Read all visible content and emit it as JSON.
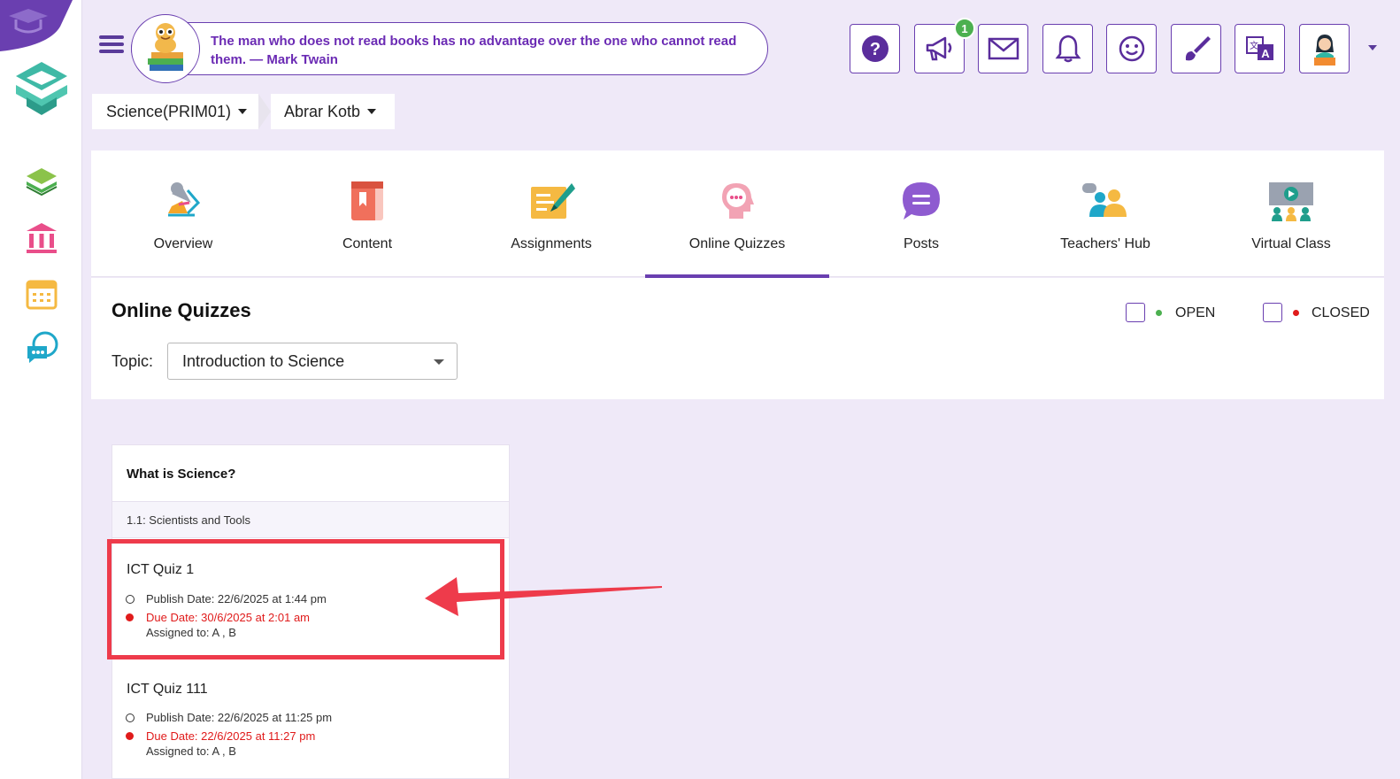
{
  "header": {
    "quote": "The man who does not read books has no advantage over the one who cannot read them. — Mark Twain",
    "notification_badge": "1",
    "buttons": [
      "help-icon",
      "megaphone-icon",
      "mail-icon",
      "bell-icon",
      "smiley-icon",
      "brush-icon",
      "translate-icon",
      "user-avatar-icon"
    ]
  },
  "breadcrumb": {
    "course": "Science(PRIM01)",
    "teacher": "Abrar Kotb"
  },
  "tabs": [
    {
      "label": "Overview",
      "icon": "overview-icon"
    },
    {
      "label": "Content",
      "icon": "book-icon"
    },
    {
      "label": "Assignments",
      "icon": "assignment-icon"
    },
    {
      "label": "Online Quizzes",
      "icon": "quiz-head-icon",
      "active": true
    },
    {
      "label": "Posts",
      "icon": "chat-bubble-icon"
    },
    {
      "label": "Teachers' Hub",
      "icon": "teachers-icon"
    },
    {
      "label": "Virtual Class",
      "icon": "virtual-class-icon"
    }
  ],
  "section": {
    "title": "Online Quizzes",
    "topic_label": "Topic:",
    "topic_value": "Introduction to Science",
    "filters": {
      "open": "OPEN",
      "closed": "CLOSED"
    }
  },
  "card": {
    "title": "What is Science?",
    "subtitle": "1.1: Scientists and Tools",
    "quizzes": [
      {
        "name": "ICT Quiz 1",
        "publish": "Publish Date: 22/6/2025 at 1:44 pm",
        "due": "Due Date: 30/6/2025 at 2:01 am",
        "assigned": "Assigned to: A , B"
      },
      {
        "name": "ICT Quiz 111",
        "publish": "Publish Date: 22/6/2025 at 11:25 pm",
        "due": "Due Date: 22/6/2025 at 11:27 pm",
        "assigned": "Assigned to: A , B"
      }
    ]
  },
  "colors": {
    "accent": "#6a3fb0",
    "open": "#4cb050",
    "closed": "#e01b1b",
    "annotation": "#ee3b4b"
  }
}
